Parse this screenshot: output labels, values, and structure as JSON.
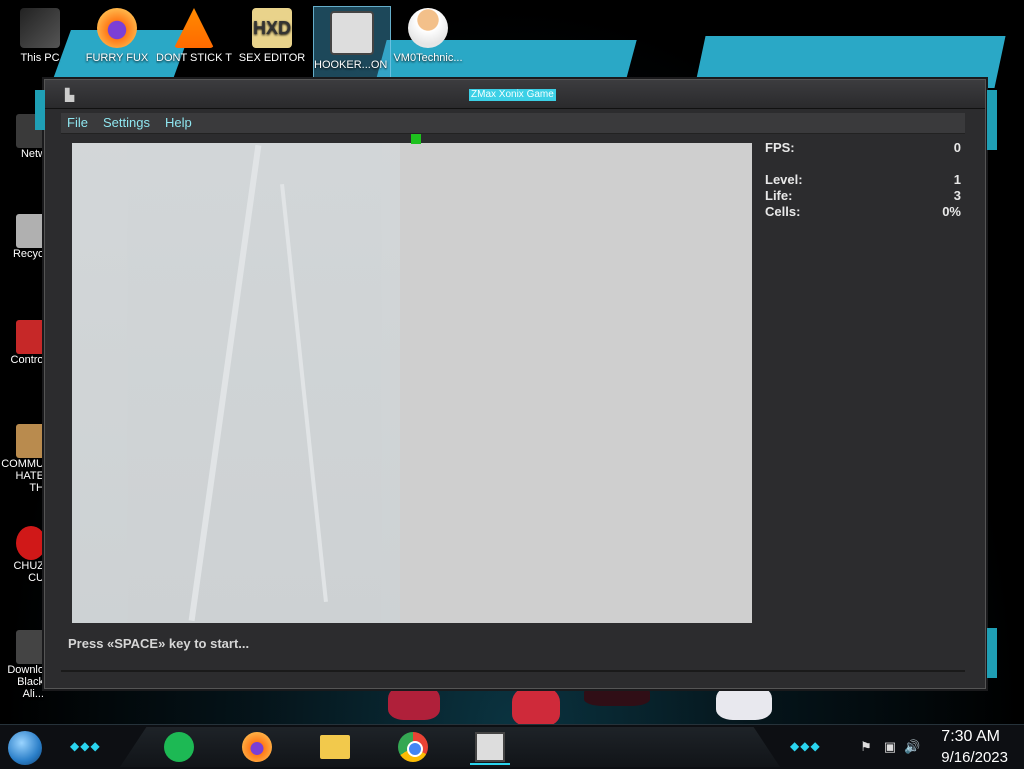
{
  "desktop": {
    "top_icons": [
      {
        "label": "This PC",
        "icon": "computer-icon"
      },
      {
        "label": "FURRY FUX",
        "icon": "firefox-icon"
      },
      {
        "label": "DONT STICK THIS IN YO...",
        "icon": "vlc-icon"
      },
      {
        "label": "SEX EDITOR",
        "icon": "hxd-icon"
      },
      {
        "label": "HOOKER...ON XON...",
        "icon": "xonix-icon"
      },
      {
        "label": "VM0Technic...",
        "icon": "doctor-icon"
      }
    ],
    "left_icons": [
      {
        "label": "Netw",
        "icon": "network-icon"
      },
      {
        "label": "Recycl",
        "icon": "recycle-bin-icon"
      },
      {
        "label": "Control",
        "icon": "control-panel-icon"
      },
      {
        "label": "COMMU HATE TH",
        "icon": "money-bag-icon"
      },
      {
        "label": "CHUZ CU",
        "icon": "red-mascot-icon"
      },
      {
        "label": "Downlo Black Ali...",
        "icon": "download-icon"
      }
    ]
  },
  "window": {
    "title": "ZMax Xonix Game",
    "menu": [
      "File",
      "Settings",
      "Help"
    ],
    "stats": {
      "fps_label": "FPS:",
      "fps_value": "0",
      "level_label": "Level:",
      "level_value": "1",
      "life_label": "Life:",
      "life_value": "3",
      "cells_label": "Cells:",
      "cells_value": "0%"
    },
    "status_message": "Press «SPACE» key to start..."
  },
  "taskbar": {
    "pinned": [
      {
        "name": "spotify-icon",
        "color": "#1db954"
      },
      {
        "name": "firefox-icon",
        "color": "#ff7a18"
      },
      {
        "name": "file-explorer-icon",
        "color": "#f2c94c"
      },
      {
        "name": "chrome-icon",
        "color": "#4285f4"
      },
      {
        "name": "xonix-app-icon",
        "color": "#bdbdbd"
      }
    ],
    "tray": [
      "flag-icon",
      "network-icon",
      "volume-icon"
    ],
    "time": "7:30 AM",
    "date": "9/16/2023"
  },
  "colors": {
    "accent": "#2aa8c6",
    "title_highlight": "#3cd0e6",
    "player": "#1ec21e",
    "menu_text": "#8fe6f0"
  }
}
